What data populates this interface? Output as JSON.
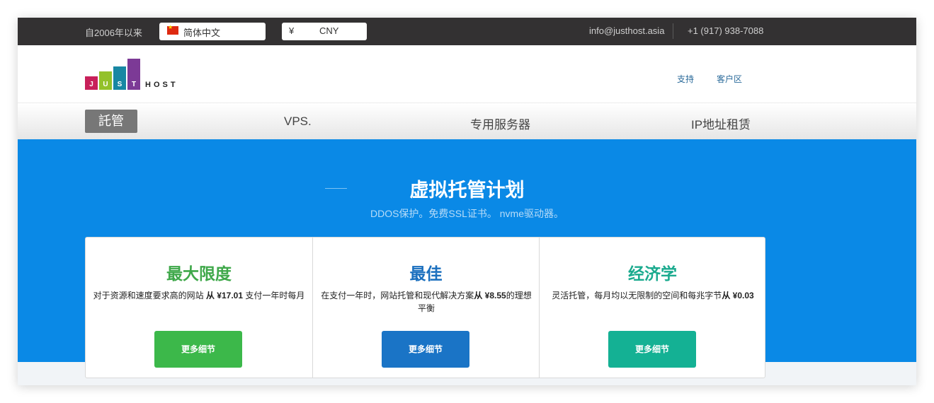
{
  "topbar": {
    "since": "自2006年以来",
    "language": "简体中文",
    "currency_symbol": "¥",
    "currency": "CNY",
    "email": "info@justhost.asia",
    "phone": "+1 (917) 938-7088"
  },
  "header": {
    "logo_letters": [
      "J",
      "U",
      "S",
      "T"
    ],
    "logo_host": "HOST",
    "links": [
      "支持",
      "客户区"
    ]
  },
  "nav": {
    "items": [
      "託管",
      "VPS.",
      "专用服务器",
      "IP地址租赁"
    ]
  },
  "hero": {
    "title": "虚拟托管计划",
    "subtitle": "DDOS保护。免费SSL证书。 nvme驱动器。"
  },
  "plans": [
    {
      "title": "最大限度",
      "desc_pre": "对于资源和速度要求高的网站 ",
      "desc_price": "从 ¥17.01",
      "desc_post": " 支付一年时每月",
      "button": "更多细节",
      "title_color": "#3fa84a",
      "button_color": "#3cb84a"
    },
    {
      "title": "最佳",
      "desc_pre": "在支付一年时，网站托管和现代解决方案",
      "desc_price": "从 ¥8.55",
      "desc_post": "的理想平衡",
      "button": "更多细节",
      "title_color": "#1a6fbe",
      "button_color": "#1a74c6"
    },
    {
      "title": "经济学",
      "desc_pre": "灵活托管，每月均以无限制的空间和每兆字节",
      "desc_price": "从 ¥0.03",
      "desc_post": "",
      "button": "更多细节",
      "title_color": "#1aaa8e",
      "button_color": "#14b194"
    }
  ],
  "colors": {
    "topbar_bg": "#333132",
    "hero_bg": "#0a89e6",
    "active_nav_bg": "#777777"
  }
}
